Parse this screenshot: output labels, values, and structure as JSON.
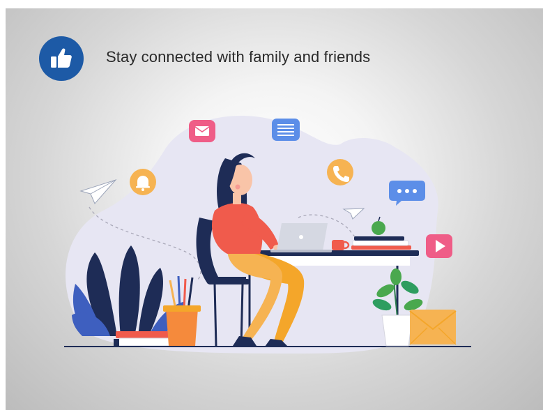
{
  "slide": {
    "headline": "Stay connected with family and friends",
    "badge_icon": "thumbs-up-icon"
  },
  "illustration": {
    "subject": "woman-working-on-laptop",
    "floating_icons": [
      "mail-icon",
      "document-icon",
      "bell-icon",
      "phone-icon",
      "chat-icon",
      "play-icon",
      "paper-plane-icon"
    ]
  },
  "colors": {
    "badge": "#1d5aa6",
    "blob": "#e7e6f3",
    "sweater": "#f05b4c",
    "pants": "#f4a62a",
    "navy": "#1e2c56"
  }
}
